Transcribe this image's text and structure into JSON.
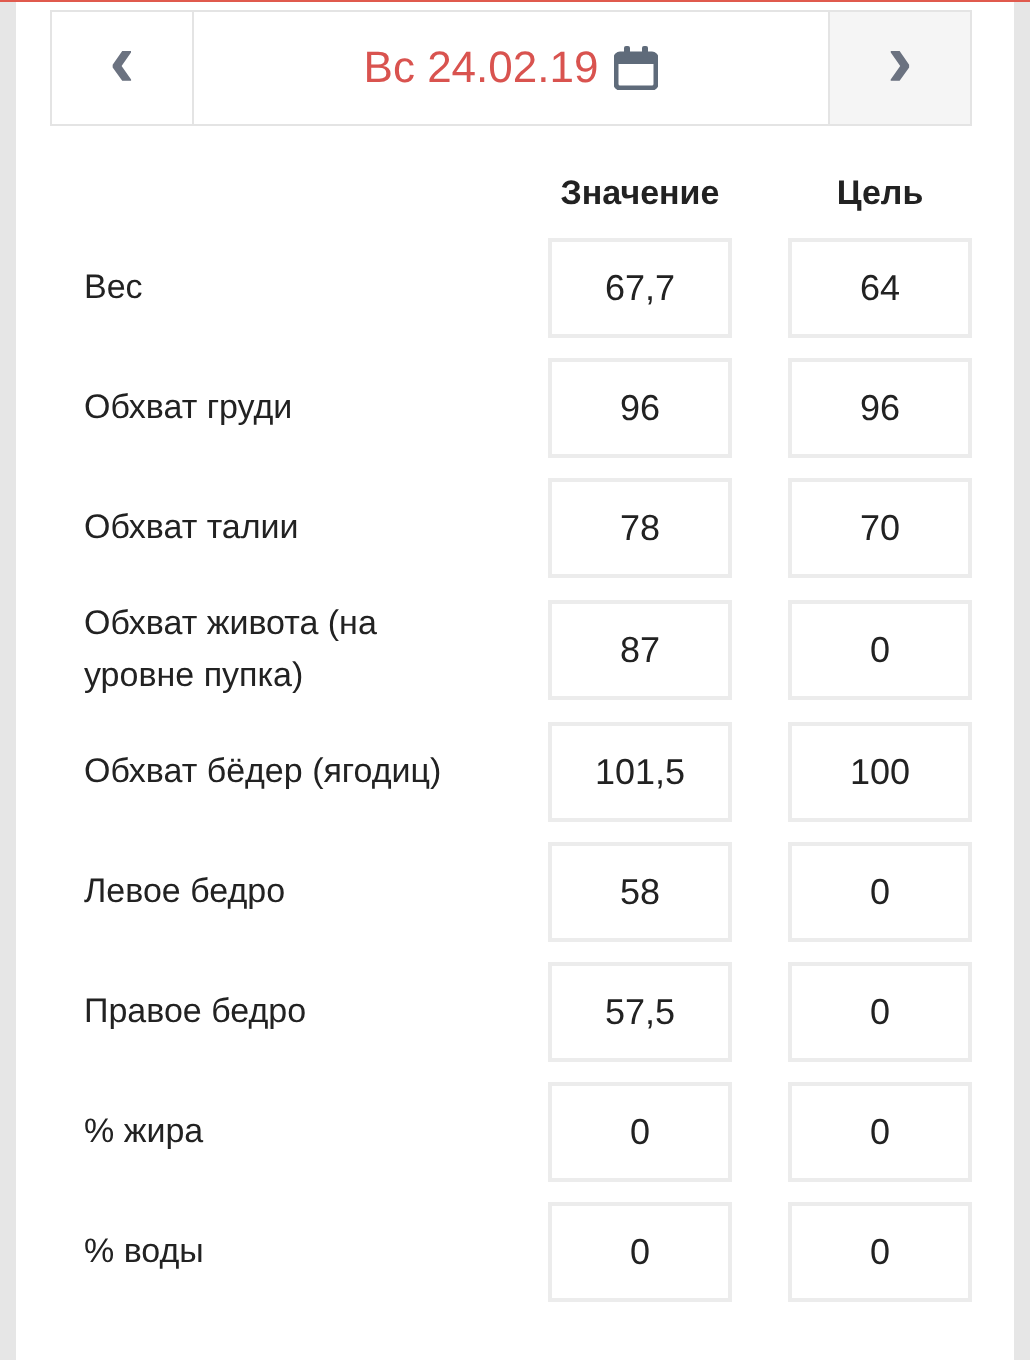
{
  "date_nav": {
    "prev": "‹",
    "date": "Вс 24.02.19",
    "next": "›"
  },
  "columns": [
    "Значение",
    "Цель"
  ],
  "rows": [
    {
      "label": "Вес",
      "value": "67,7",
      "goal": "64"
    },
    {
      "label": "Обхват груди",
      "value": "96",
      "goal": "96"
    },
    {
      "label": "Обхват талии",
      "value": "78",
      "goal": "70"
    },
    {
      "label": "Обхват живота (на уровне пупка)",
      "value": "87",
      "goal": "0"
    },
    {
      "label": "Обхват бёдер (ягодиц)",
      "value": "101,5",
      "goal": "100"
    },
    {
      "label": "Левое бедро",
      "value": "58",
      "goal": "0"
    },
    {
      "label": "Правое бедро",
      "value": "57,5",
      "goal": "0"
    },
    {
      "label": "% жира",
      "value": "0",
      "goal": "0"
    },
    {
      "label": "% воды",
      "value": "0",
      "goal": "0"
    }
  ]
}
